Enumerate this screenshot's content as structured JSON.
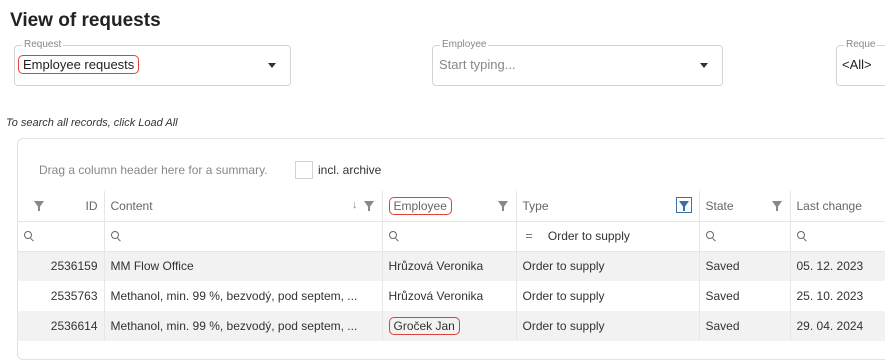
{
  "page": {
    "title": "View of requests"
  },
  "filters": {
    "request": {
      "label": "Request",
      "value": "Employee requests"
    },
    "employee": {
      "label": "Employee",
      "placeholder": "Start typing..."
    },
    "third": {
      "label": "Reque",
      "value": "<All>"
    }
  },
  "note": "To search all records, click Load All",
  "grid": {
    "group_hint": "Drag a column header here for a summary.",
    "archive_label": "incl. archive",
    "columns": {
      "id": "ID",
      "content": "Content",
      "employee": "Employee",
      "type": "Type",
      "state": "State",
      "last_change": "Last change"
    },
    "type_filter": {
      "operator": "=",
      "value": "Order to supply"
    },
    "rows": [
      {
        "id": "2536159",
        "content": "MM Flow Office",
        "employee": "Hrůzová Veronika",
        "type": "Order to supply",
        "state": "Saved",
        "last_change": "05. 12. 2023"
      },
      {
        "id": "2535763",
        "content": "Methanol, min. 99 %, bezvodý, pod septem, ...",
        "employee": "Hrůzová Veronika",
        "type": "Order to supply",
        "state": "Saved",
        "last_change": "25. 10. 2023"
      },
      {
        "id": "2536614",
        "content": "Methanol, min. 99 %, bezvodý, pod septem, ...",
        "employee": "Groček Jan",
        "type": "Order to supply",
        "state": "Saved",
        "last_change": "29. 04. 2024"
      }
    ]
  },
  "colors": {
    "highlight": "#d9453a",
    "active_filter": "#3a6fa8",
    "alt_row": "#f2f2f2"
  },
  "icons": [
    "chevron-down-icon",
    "filter-icon",
    "sort-down-icon",
    "search-icon"
  ]
}
